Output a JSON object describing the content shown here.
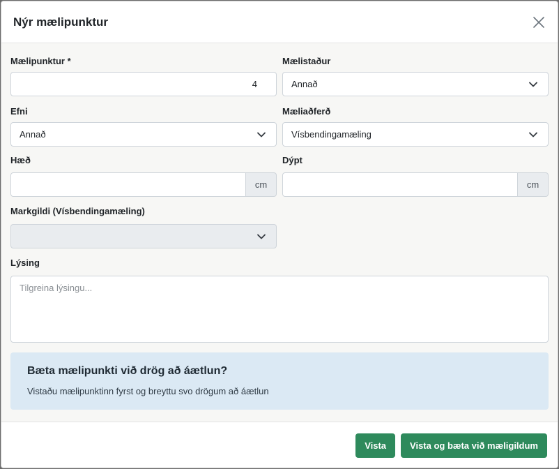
{
  "dialog": {
    "title": "Nýr mælipunktur"
  },
  "form": {
    "measurement_point": {
      "label": "Mælipunktur *",
      "value": "4"
    },
    "location": {
      "label": "Mælistaður",
      "value": "Annað"
    },
    "material": {
      "label": "Efni",
      "value": "Annað"
    },
    "method": {
      "label": "Mæliaðferð",
      "value": "Vísbendingamæling"
    },
    "height": {
      "label": "Hæð",
      "value": "",
      "unit": "cm"
    },
    "depth": {
      "label": "Dýpt",
      "value": "",
      "unit": "cm"
    },
    "target_value": {
      "label": "Markgildi (Vísbendingamæling)",
      "value": ""
    },
    "description": {
      "label": "Lýsing",
      "placeholder": "Tilgreina lýsingu..."
    }
  },
  "alert": {
    "title": "Bæta mælipunkti við drög að áætlun?",
    "text": "Vistaðu mælipunktinn fyrst og breyttu svo drögum að áætlun"
  },
  "footer": {
    "save_label": "Vista",
    "save_add_label": "Vista og bæta við mæligildum"
  },
  "icons": {
    "close": "close-icon",
    "chevron": "chevron-down-icon"
  },
  "colors": {
    "primary_button": "#2e8a5c",
    "alert_bg": "#dbe9f4",
    "body_bg": "#f7f7f5"
  }
}
